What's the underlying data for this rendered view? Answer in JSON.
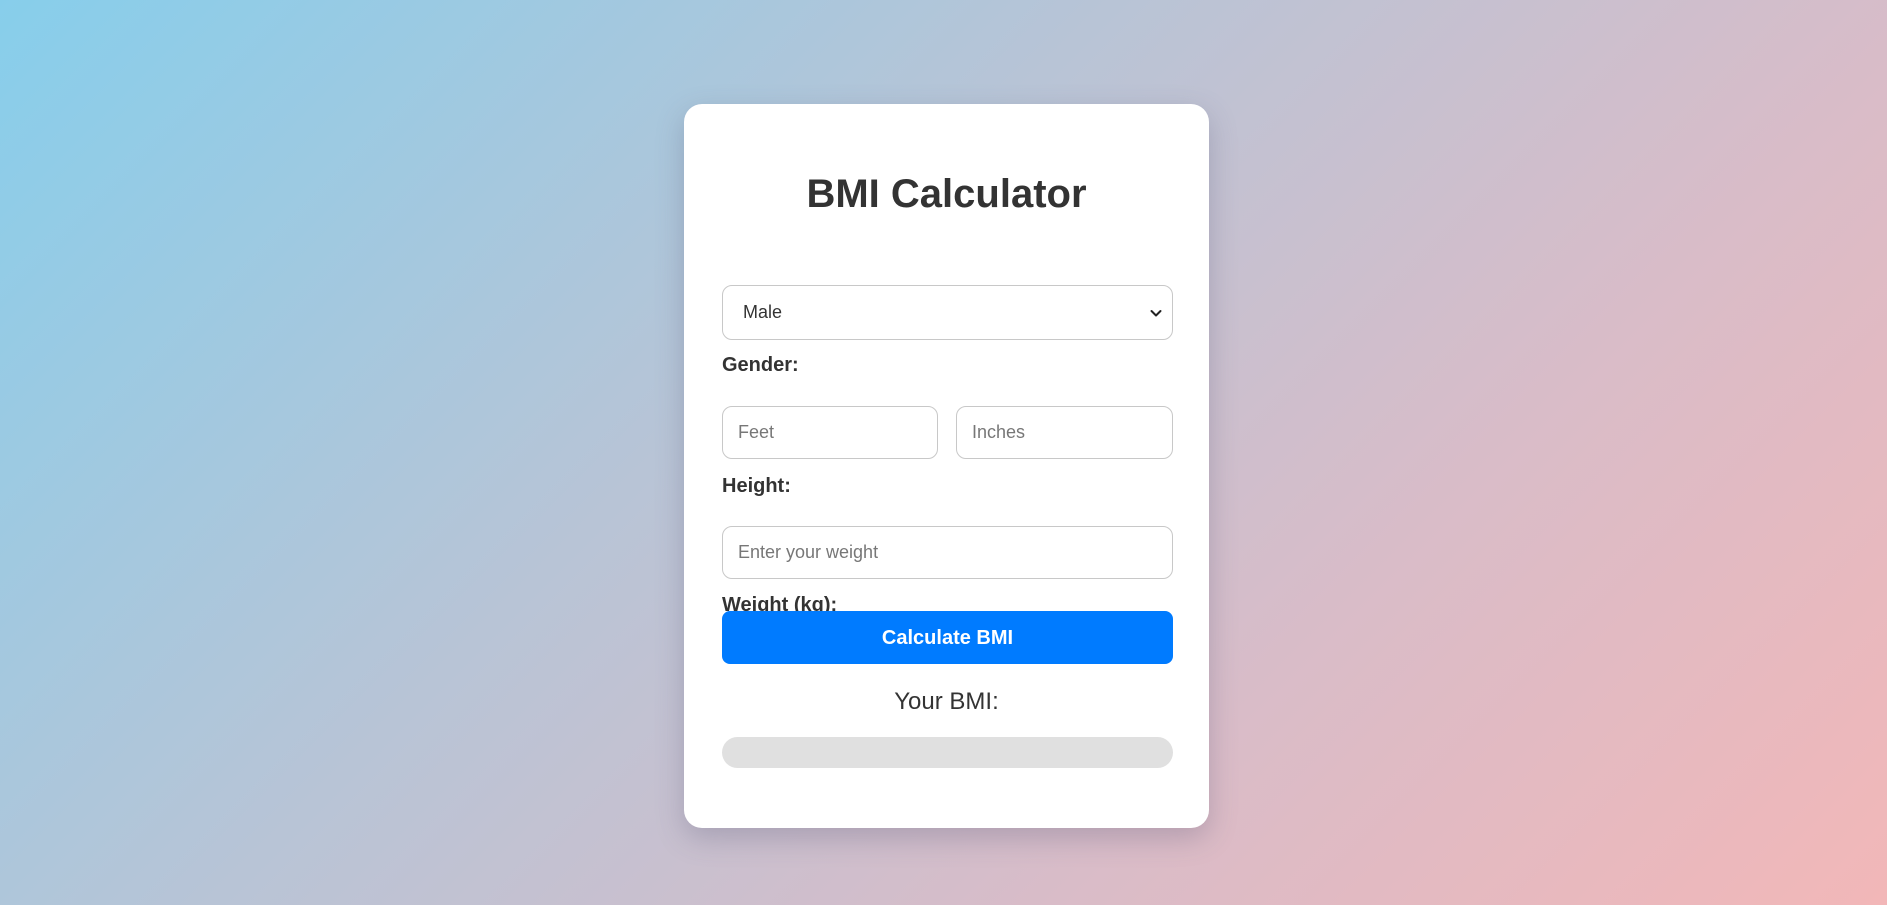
{
  "page": {
    "title": "BMI Calculator"
  },
  "form": {
    "gender_label": "Gender:",
    "gender_selected": "Male",
    "height_label": "Height:",
    "feet_placeholder": "Feet",
    "inches_placeholder": "Inches",
    "weight_label": "Weight (kg):",
    "weight_placeholder": "Enter your weight",
    "calculate_label": "Calculate BMI"
  },
  "result": {
    "label": "Your BMI:",
    "progress_fraction": 0
  },
  "colors": {
    "accent": "#007bff",
    "track": "#e0e0e0",
    "text": "#333333"
  },
  "icons": {
    "select_arrow": "chevron-down-icon"
  }
}
